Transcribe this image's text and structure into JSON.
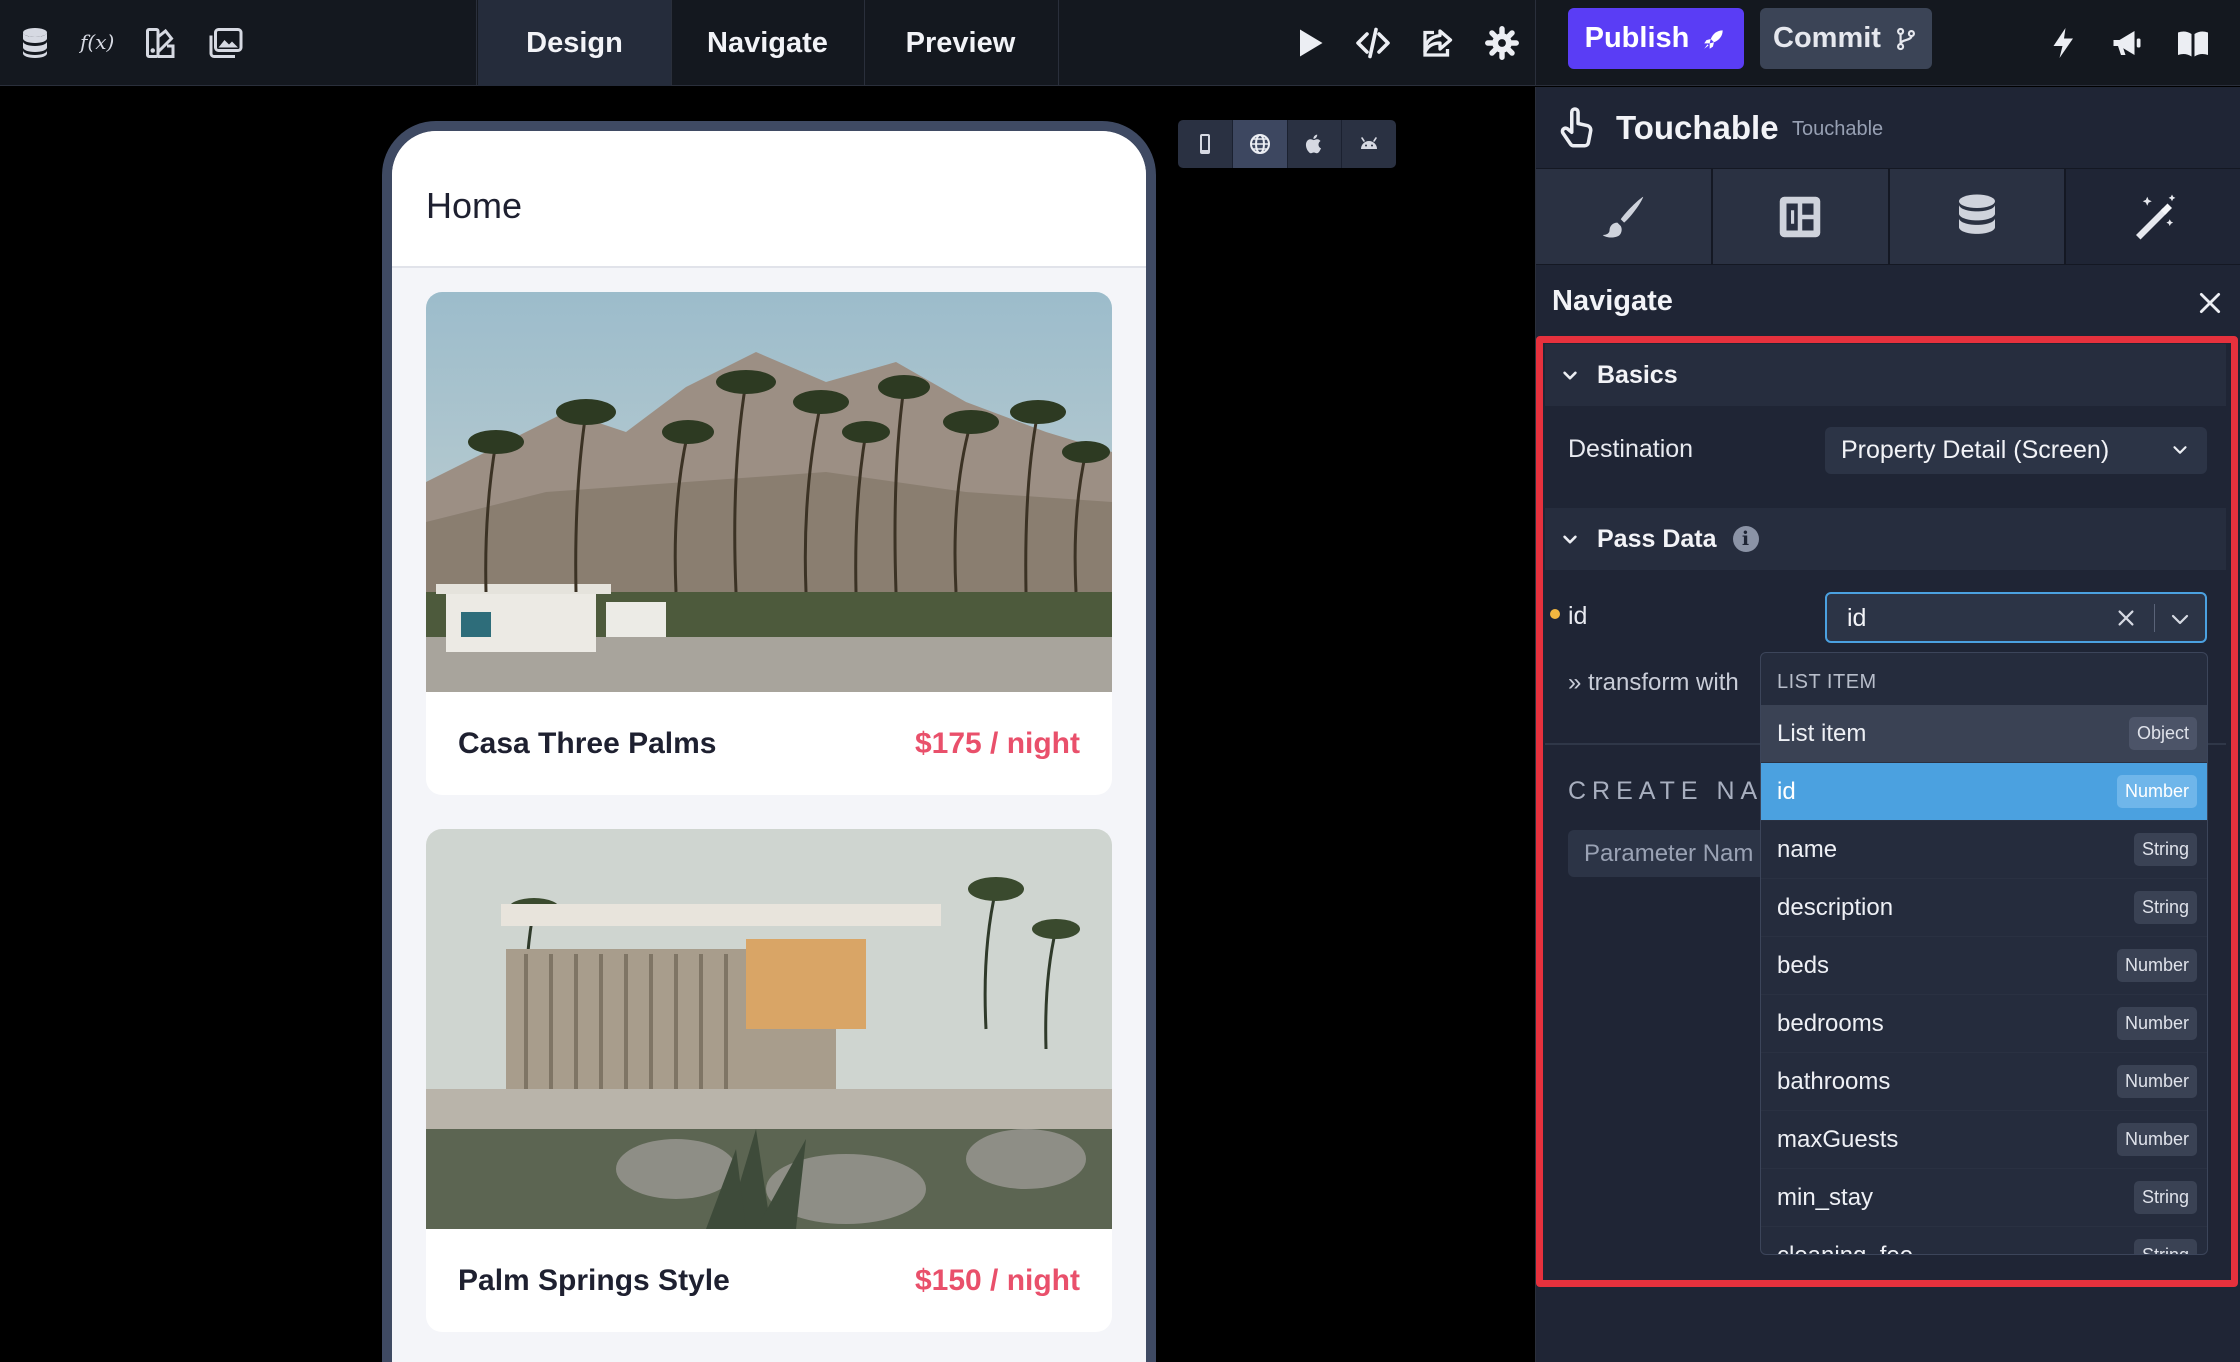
{
  "topbar": {
    "modes": [
      "Design",
      "Navigate",
      "Preview"
    ],
    "active_mode": "Design",
    "publish_label": "Publish",
    "commit_label": "Commit",
    "accent": "#5a3df5"
  },
  "device_bar": {
    "devices": [
      "phone-icon",
      "web-globe-icon",
      "apple-icon",
      "android-icon"
    ],
    "active": "web-globe-icon"
  },
  "phone": {
    "title": "Home",
    "cards": [
      {
        "name": "Casa Three Palms",
        "price": "$175 / night"
      },
      {
        "name": "Palm Springs Style",
        "price": "$150 / night"
      }
    ]
  },
  "panel": {
    "component_name": "Touchable",
    "component_type": "Touchable",
    "tabs": [
      "brush-icon",
      "layout-icon",
      "database-icon",
      "magic-wand-icon"
    ],
    "active_tab": "magic-wand-icon",
    "action_title": "Navigate",
    "basics": {
      "label": "Basics",
      "destination_label": "Destination",
      "destination_value": "Property Detail (Screen)"
    },
    "pass_data": {
      "label": "Pass Data",
      "param_name": "id",
      "param_value": "id",
      "transform_label": "» transform with",
      "create_nav_label": "CREATE NAV",
      "param_placeholder": "Parameter Nam"
    },
    "highlight_color": "#e6313d"
  },
  "dropdown": {
    "group_label": "LIST ITEM",
    "items": [
      {
        "name": "List item",
        "type": "Object",
        "state": "hover"
      },
      {
        "name": "id",
        "type": "Number",
        "state": "selected"
      },
      {
        "name": "name",
        "type": "String",
        "state": ""
      },
      {
        "name": "description",
        "type": "String",
        "state": ""
      },
      {
        "name": "beds",
        "type": "Number",
        "state": ""
      },
      {
        "name": "bedrooms",
        "type": "Number",
        "state": ""
      },
      {
        "name": "bathrooms",
        "type": "Number",
        "state": ""
      },
      {
        "name": "maxGuests",
        "type": "Number",
        "state": ""
      },
      {
        "name": "min_stay",
        "type": "String",
        "state": ""
      },
      {
        "name": "cleaning_fee",
        "type": "String",
        "state": ""
      }
    ]
  }
}
